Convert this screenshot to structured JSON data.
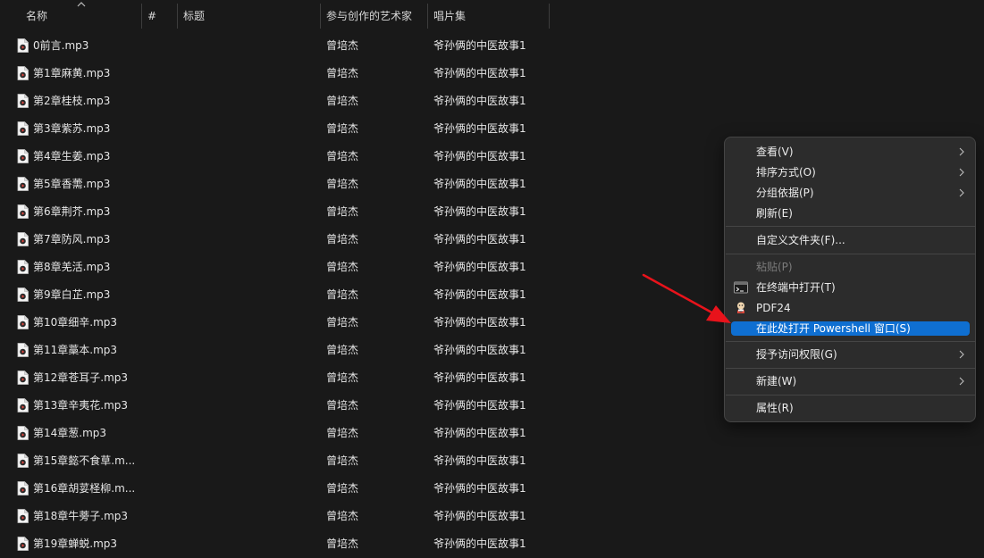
{
  "columns": {
    "name": "名称",
    "number": "#",
    "title": "标题",
    "artist": "参与创作的艺术家",
    "album": "唱片集"
  },
  "files": [
    {
      "name": "0前言.mp3",
      "artist": "曾培杰",
      "album": "爷孙俩的中医故事1"
    },
    {
      "name": "第1章麻黄.mp3",
      "artist": "曾培杰",
      "album": "爷孙俩的中医故事1"
    },
    {
      "name": "第2章桂枝.mp3",
      "artist": "曾培杰",
      "album": "爷孙俩的中医故事1"
    },
    {
      "name": "第3章紫苏.mp3",
      "artist": "曾培杰",
      "album": "爷孙俩的中医故事1"
    },
    {
      "name": "第4章生姜.mp3",
      "artist": "曾培杰",
      "album": "爷孙俩的中医故事1"
    },
    {
      "name": "第5章香薷.mp3",
      "artist": "曾培杰",
      "album": "爷孙俩的中医故事1"
    },
    {
      "name": "第6章荆芥.mp3",
      "artist": "曾培杰",
      "album": "爷孙俩的中医故事1"
    },
    {
      "name": "第7章防风.mp3",
      "artist": "曾培杰",
      "album": "爷孙俩的中医故事1"
    },
    {
      "name": "第8章羌活.mp3",
      "artist": "曾培杰",
      "album": "爷孙俩的中医故事1"
    },
    {
      "name": "第9章白芷.mp3",
      "artist": "曾培杰",
      "album": "爷孙俩的中医故事1"
    },
    {
      "name": "第10章细辛.mp3",
      "artist": "曾培杰",
      "album": "爷孙俩的中医故事1"
    },
    {
      "name": "第11章藁本.mp3",
      "artist": "曾培杰",
      "album": "爷孙俩的中医故事1"
    },
    {
      "name": "第12章苍耳子.mp3",
      "artist": "曾培杰",
      "album": "爷孙俩的中医故事1"
    },
    {
      "name": "第13章辛夷花.mp3",
      "artist": "曾培杰",
      "album": "爷孙俩的中医故事1"
    },
    {
      "name": "第14章葱.mp3",
      "artist": "曾培杰",
      "album": "爷孙俩的中医故事1"
    },
    {
      "name": "第15章懿不食草.m...",
      "artist": "曾培杰",
      "album": "爷孙俩的中医故事1"
    },
    {
      "name": "第16章胡荽柽柳.m...",
      "artist": "曾培杰",
      "album": "爷孙俩的中医故事1"
    },
    {
      "name": "第18章牛蒡子.mp3",
      "artist": "曾培杰",
      "album": "爷孙俩的中医故事1"
    },
    {
      "name": "第19章蝉蜕.mp3",
      "artist": "曾培杰",
      "album": "爷孙俩的中医故事1"
    }
  ],
  "file_icon": "audio-file-icon",
  "context_menu": {
    "view": "查看(V)",
    "sort": "排序方式(O)",
    "group": "分组依据(P)",
    "refresh": "刷新(E)",
    "customize": "自定义文件夹(F)...",
    "paste": "粘贴(P)",
    "open_terminal": "在终端中打开(T)",
    "pdf24": "PDF24",
    "open_powershell": "在此处打开 Powershell 窗口(S)",
    "grant_access": "授予访问权限(G)",
    "new": "新建(W)",
    "properties": "属性(R)"
  },
  "colors": {
    "background": "#191919",
    "menu_background": "#2c2c2c",
    "highlight": "#0f6fd1",
    "arrow": "#e8131b"
  }
}
